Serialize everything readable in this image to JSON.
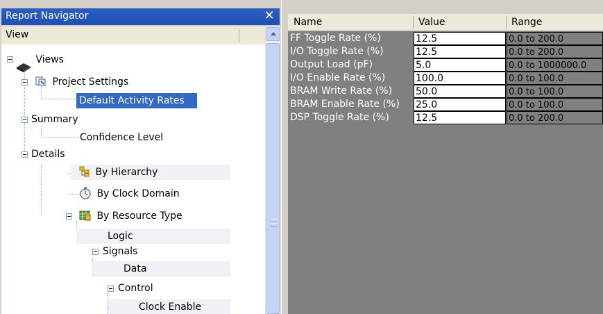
{
  "navigator": {
    "title": "Report Navigator",
    "close_glyph": "✕",
    "view_header": "View",
    "tree": {
      "views": "Views",
      "project_settings": "Project Settings",
      "default_activity_rates": "Default Activity Rates",
      "summary": "Summary",
      "confidence_level": "Confidence Level",
      "details": "Details",
      "by_hierarchy": "By Hierarchy",
      "by_clock_domain": "By Clock Domain",
      "by_resource_type": "By Resource Type",
      "logic": "Logic",
      "signals": "Signals",
      "data": "Data",
      "control": "Control",
      "clock_enable": "Clock Enable"
    },
    "selected_item": "Default Activity Rates",
    "selection_color": "#316ac5"
  },
  "grid": {
    "columns": [
      "Name",
      "Value",
      "Range"
    ],
    "rows": [
      {
        "name": "FF Toggle Rate (%)",
        "value": "12.5",
        "range": "0.0 to 200.0"
      },
      {
        "name": "I/O Toggle Rate (%)",
        "value": "12.5",
        "range": "0.0 to 200.0"
      },
      {
        "name": "Output Load (pF)",
        "value": "5.0",
        "range": "0.0 to 1000000.0"
      },
      {
        "name": "I/O Enable Rate (%)",
        "value": "100.0",
        "range": "0.0 to 100.0"
      },
      {
        "name": "BRAM Write Rate (%)",
        "value": "50.0",
        "range": "0.0 to 100.0"
      },
      {
        "name": "BRAM Enable Rate (%)",
        "value": "25.0",
        "range": "0.0 to 100.0"
      },
      {
        "name": "DSP Toggle Rate (%)",
        "value": "12.5",
        "range": "0.0 to 200.0"
      }
    ],
    "background_color": "#808080"
  }
}
